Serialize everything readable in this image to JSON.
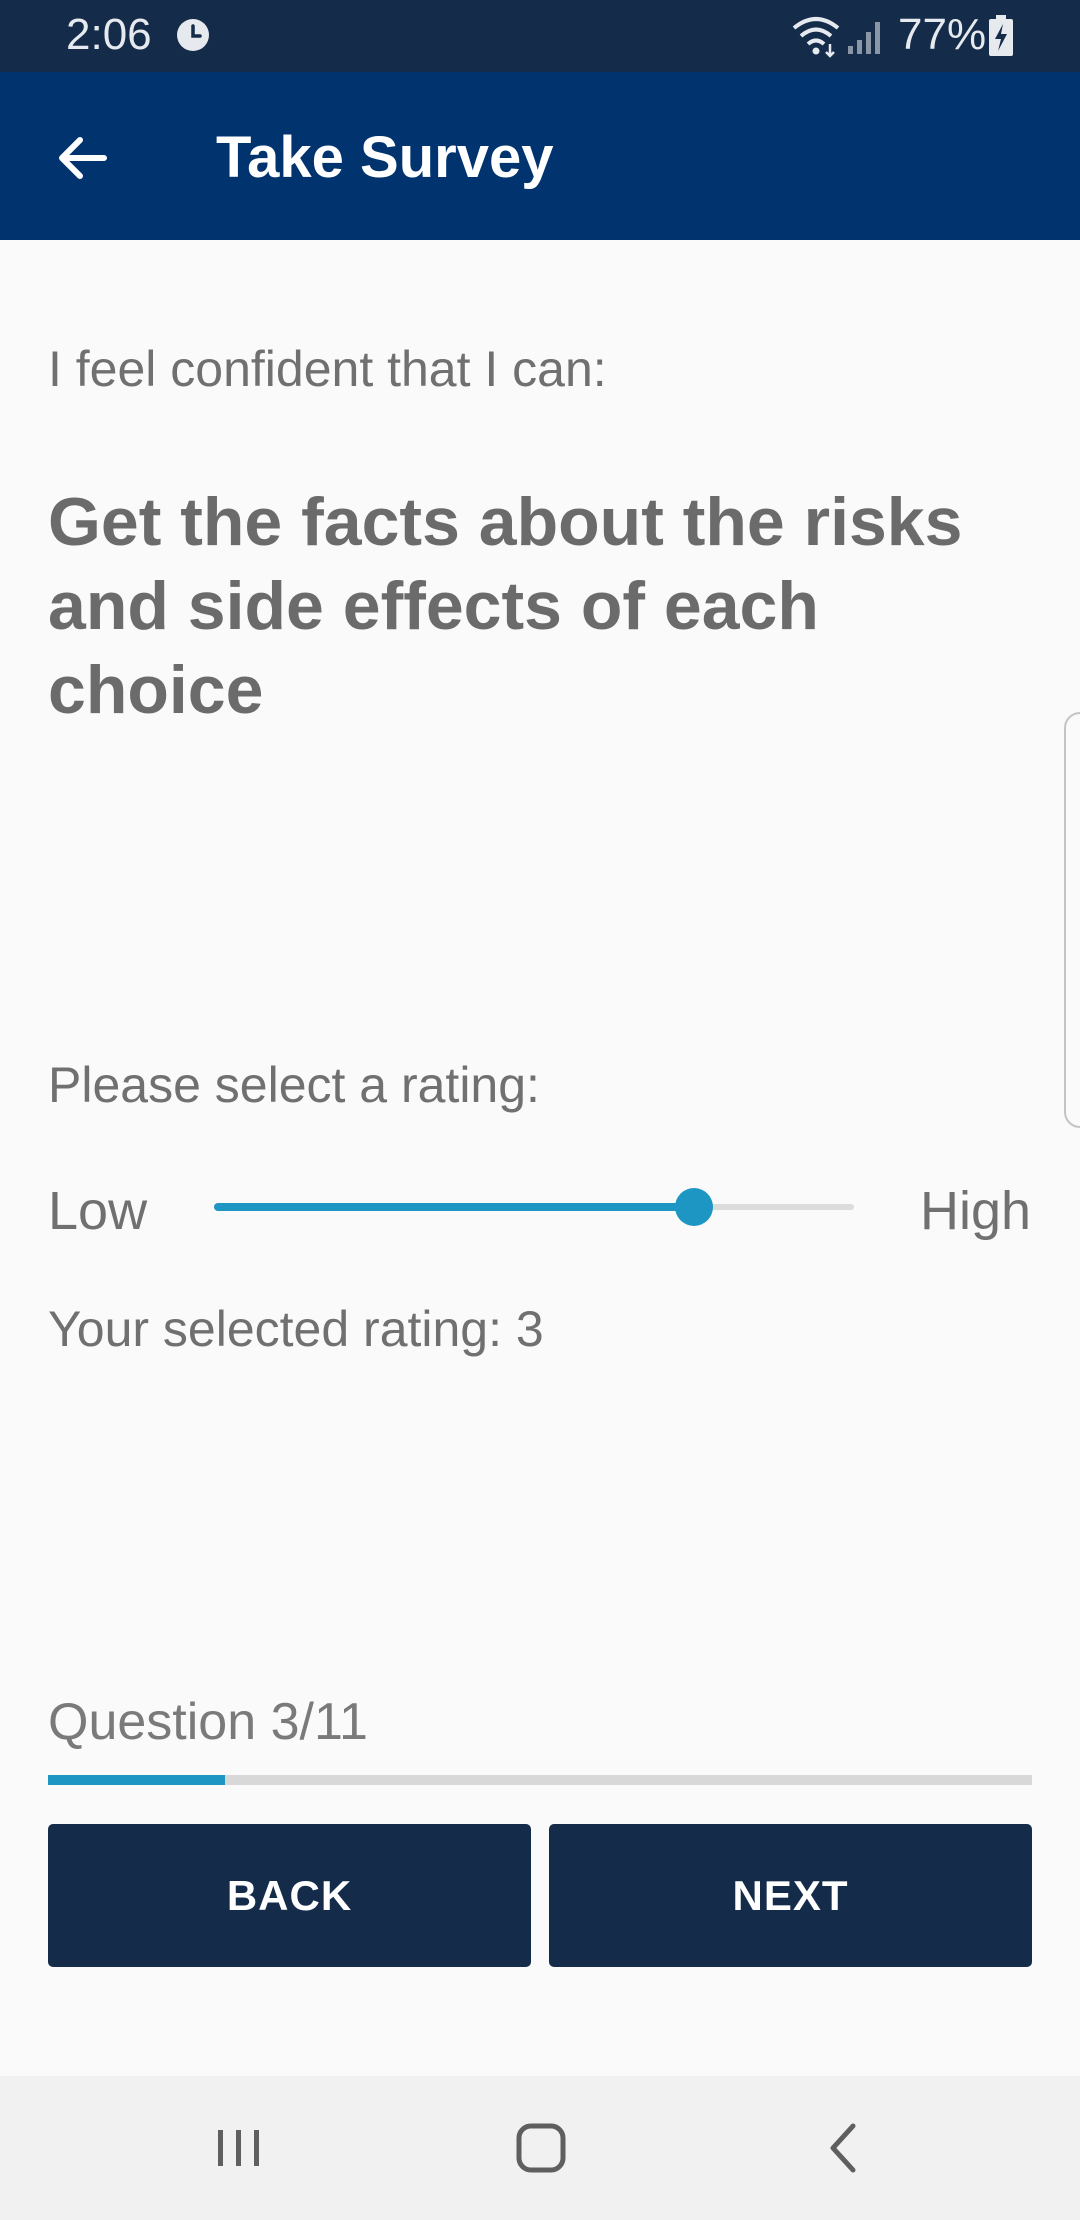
{
  "status_bar": {
    "time": "2:06",
    "battery": "77%",
    "icons": [
      "alarm-icon",
      "wifi-icon",
      "signal-icon",
      "battery-charging-icon"
    ]
  },
  "app_bar": {
    "title": "Take Survey",
    "back_icon": "arrow-left-icon"
  },
  "survey": {
    "prompt": "I feel confident that I can:",
    "question": "Get the facts about the risks and side effects of each choice",
    "rating_label": "Please select a rating:",
    "low_label": "Low",
    "high_label": "High",
    "selected_rating_text": "Your selected rating: 3",
    "slider_value": 3,
    "slider_min": 0,
    "slider_max": 4
  },
  "progress": {
    "label": "Question 3/11",
    "current": 3,
    "total": 11,
    "fraction": 0.18
  },
  "buttons": {
    "back": "BACK",
    "next": "NEXT"
  },
  "system_nav": {
    "icons": [
      "recents-icon",
      "home-icon",
      "back-chevron-icon"
    ]
  },
  "colors": {
    "status_bar": "#142b4a",
    "app_bar": "#01346f",
    "accent": "#1d96c4",
    "button": "#142b4a",
    "text": "#707070"
  }
}
